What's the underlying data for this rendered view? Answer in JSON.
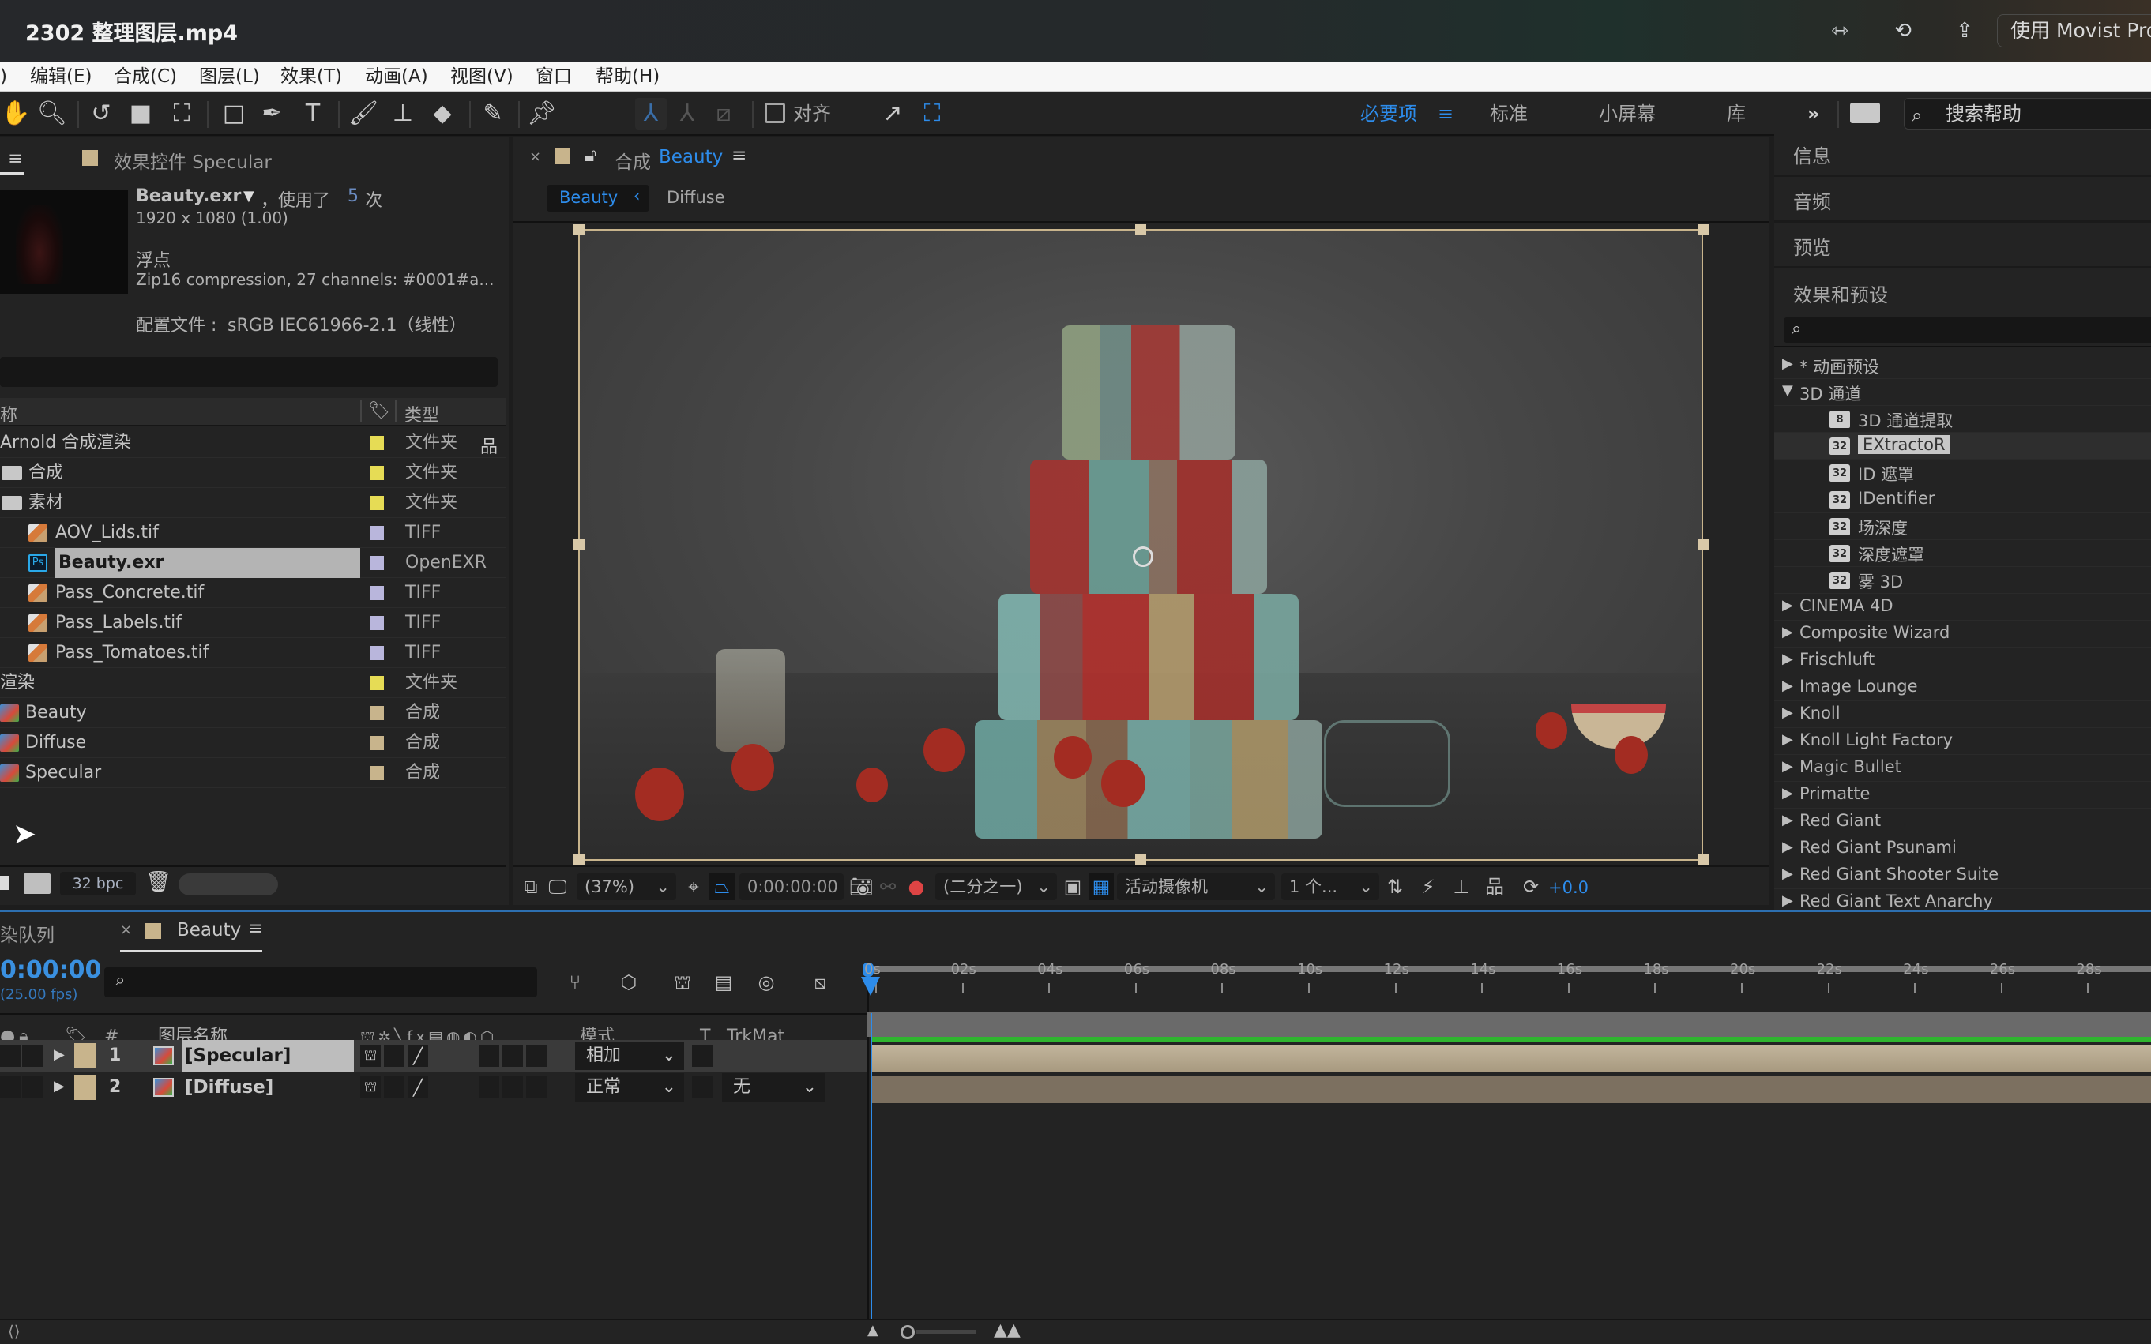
{
  "window": {
    "title": "2302 整理图层.mp4",
    "player_button": "使用 Movist Pro"
  },
  "menu": [
    "编辑(E)",
    "合成(C)",
    "图层(L)",
    "效果(T)",
    "动画(A)",
    "视图(V)",
    "窗口",
    "帮助(H)"
  ],
  "toolbar": {
    "align_label": "对齐",
    "workspaces": [
      "必要项",
      "标准",
      "小屏幕",
      "库"
    ],
    "active_workspace": "必要项",
    "help_search_placeholder": "搜索帮助",
    "more": "»"
  },
  "left_panel": {
    "tab_label": "效果控件 Specular",
    "footage": {
      "name": "Beauty.exr",
      "usage": "，使用了",
      "usage_count": "5",
      "usage_unit": "次",
      "dimensions": "1920 x 1080 (1.00)",
      "depth": "浮点",
      "details": "Zip16 compression, 27 channels: #0001#a...",
      "profile_label": "配置文件 :",
      "profile_value": "sRGB IEC61966-2.1（线性）"
    },
    "columns": {
      "name": "称",
      "type": "类型"
    },
    "items": [
      {
        "name": "Arnold 合成渲染",
        "type": "文件夹",
        "label_color": "#e6dc55",
        "kind": "folder-root"
      },
      {
        "name": "合成",
        "type": "文件夹",
        "label_color": "#e6dc55",
        "kind": "folder"
      },
      {
        "name": "素材",
        "type": "文件夹",
        "label_color": "#e6dc55",
        "kind": "folder"
      },
      {
        "name": "AOV_Lids.tif",
        "type": "TIFF",
        "label_color": "#b9b6dc",
        "kind": "tif"
      },
      {
        "name": "Beauty.exr",
        "type": "OpenEXR",
        "label_color": "#b9b6dc",
        "kind": "psd",
        "selected": true
      },
      {
        "name": "Pass_Concrete.tif",
        "type": "TIFF",
        "label_color": "#b9b6dc",
        "kind": "tif"
      },
      {
        "name": "Pass_Labels.tif",
        "type": "TIFF",
        "label_color": "#b9b6dc",
        "kind": "tif"
      },
      {
        "name": "Pass_Tomatoes.tif",
        "type": "TIFF",
        "label_color": "#b9b6dc",
        "kind": "tif"
      },
      {
        "name": "渲染",
        "type": "文件夹",
        "label_color": "#e6dc55",
        "kind": "folder-root"
      },
      {
        "name": "Beauty",
        "type": "合成",
        "label_color": "#c8b48c",
        "kind": "comp"
      },
      {
        "name": "Diffuse",
        "type": "合成",
        "label_color": "#c8b48c",
        "kind": "comp"
      },
      {
        "name": "Specular",
        "type": "合成",
        "label_color": "#c8b48c",
        "kind": "comp"
      }
    ],
    "bit_depth": "32 bpc"
  },
  "viewer": {
    "tab_prefix": "合成",
    "tab_comp": "Beauty",
    "breadcrumbs": [
      "Beauty",
      "Diffuse"
    ],
    "zoom": "(37%)",
    "timecode": "0:00:00:00",
    "resolution": "(二分之一)",
    "camera": "活动摄像机",
    "views": "1 个...",
    "exposure": "+0.0"
  },
  "right_panel": {
    "sections": [
      "信息",
      "音频",
      "预览",
      "效果和预设"
    ],
    "search_placeholder": "",
    "tree": [
      {
        "label": "* 动画预设",
        "expanded": false
      },
      {
        "label": "3D 通道",
        "expanded": true,
        "children": [
          {
            "label": "3D 通道提取",
            "bpc": "8"
          },
          {
            "label": "EXtractoR",
            "bpc": "32",
            "selected": true
          },
          {
            "label": "ID 遮罩",
            "bpc": "32"
          },
          {
            "label": "IDentifier",
            "bpc": "32"
          },
          {
            "label": "场深度",
            "bpc": "32"
          },
          {
            "label": "深度遮罩",
            "bpc": "32"
          },
          {
            "label": "雾 3D",
            "bpc": "32"
          }
        ]
      },
      {
        "label": "CINEMA 4D",
        "expanded": false
      },
      {
        "label": "Composite Wizard",
        "expanded": false
      },
      {
        "label": "Frischluft",
        "expanded": false
      },
      {
        "label": "Image Lounge",
        "expanded": false
      },
      {
        "label": "Knoll",
        "expanded": false
      },
      {
        "label": "Knoll Light Factory",
        "expanded": false
      },
      {
        "label": "Magic Bullet",
        "expanded": false
      },
      {
        "label": "Primatte",
        "expanded": false
      },
      {
        "label": "Red Giant",
        "expanded": false
      },
      {
        "label": "Red Giant Psunami",
        "expanded": false
      },
      {
        "label": "Red Giant Shooter Suite",
        "expanded": false
      },
      {
        "label": "Red Giant Text Anarchy",
        "expanded": false
      }
    ]
  },
  "timeline": {
    "tabs": [
      "染队列",
      "Beauty"
    ],
    "timecode": "0:00:00",
    "fps": "(25.00 fps)",
    "search_placeholder": "",
    "columns": {
      "num": "#",
      "layer_name": "图层名称",
      "mode": "模式",
      "t": "T",
      "trkmat": "TrkMat"
    },
    "layers": [
      {
        "num": "1",
        "name": "[Specular]",
        "mode": "相加",
        "trkmat": "",
        "selected": true
      },
      {
        "num": "2",
        "name": "[Diffuse]",
        "mode": "正常",
        "trkmat": "无",
        "selected": false
      }
    ],
    "ruler": [
      "0s",
      "02s",
      "04s",
      "06s",
      "08s",
      "10s",
      "12s",
      "14s",
      "16s",
      "18s",
      "20s",
      "22s",
      "24s",
      "26s",
      "28s"
    ]
  },
  "colors": {
    "accent_blue": "#2d8ceb",
    "work_area_green": "#2fb52f",
    "layer_bar": "#b3a68c",
    "label_tan": "#c8b48c"
  }
}
